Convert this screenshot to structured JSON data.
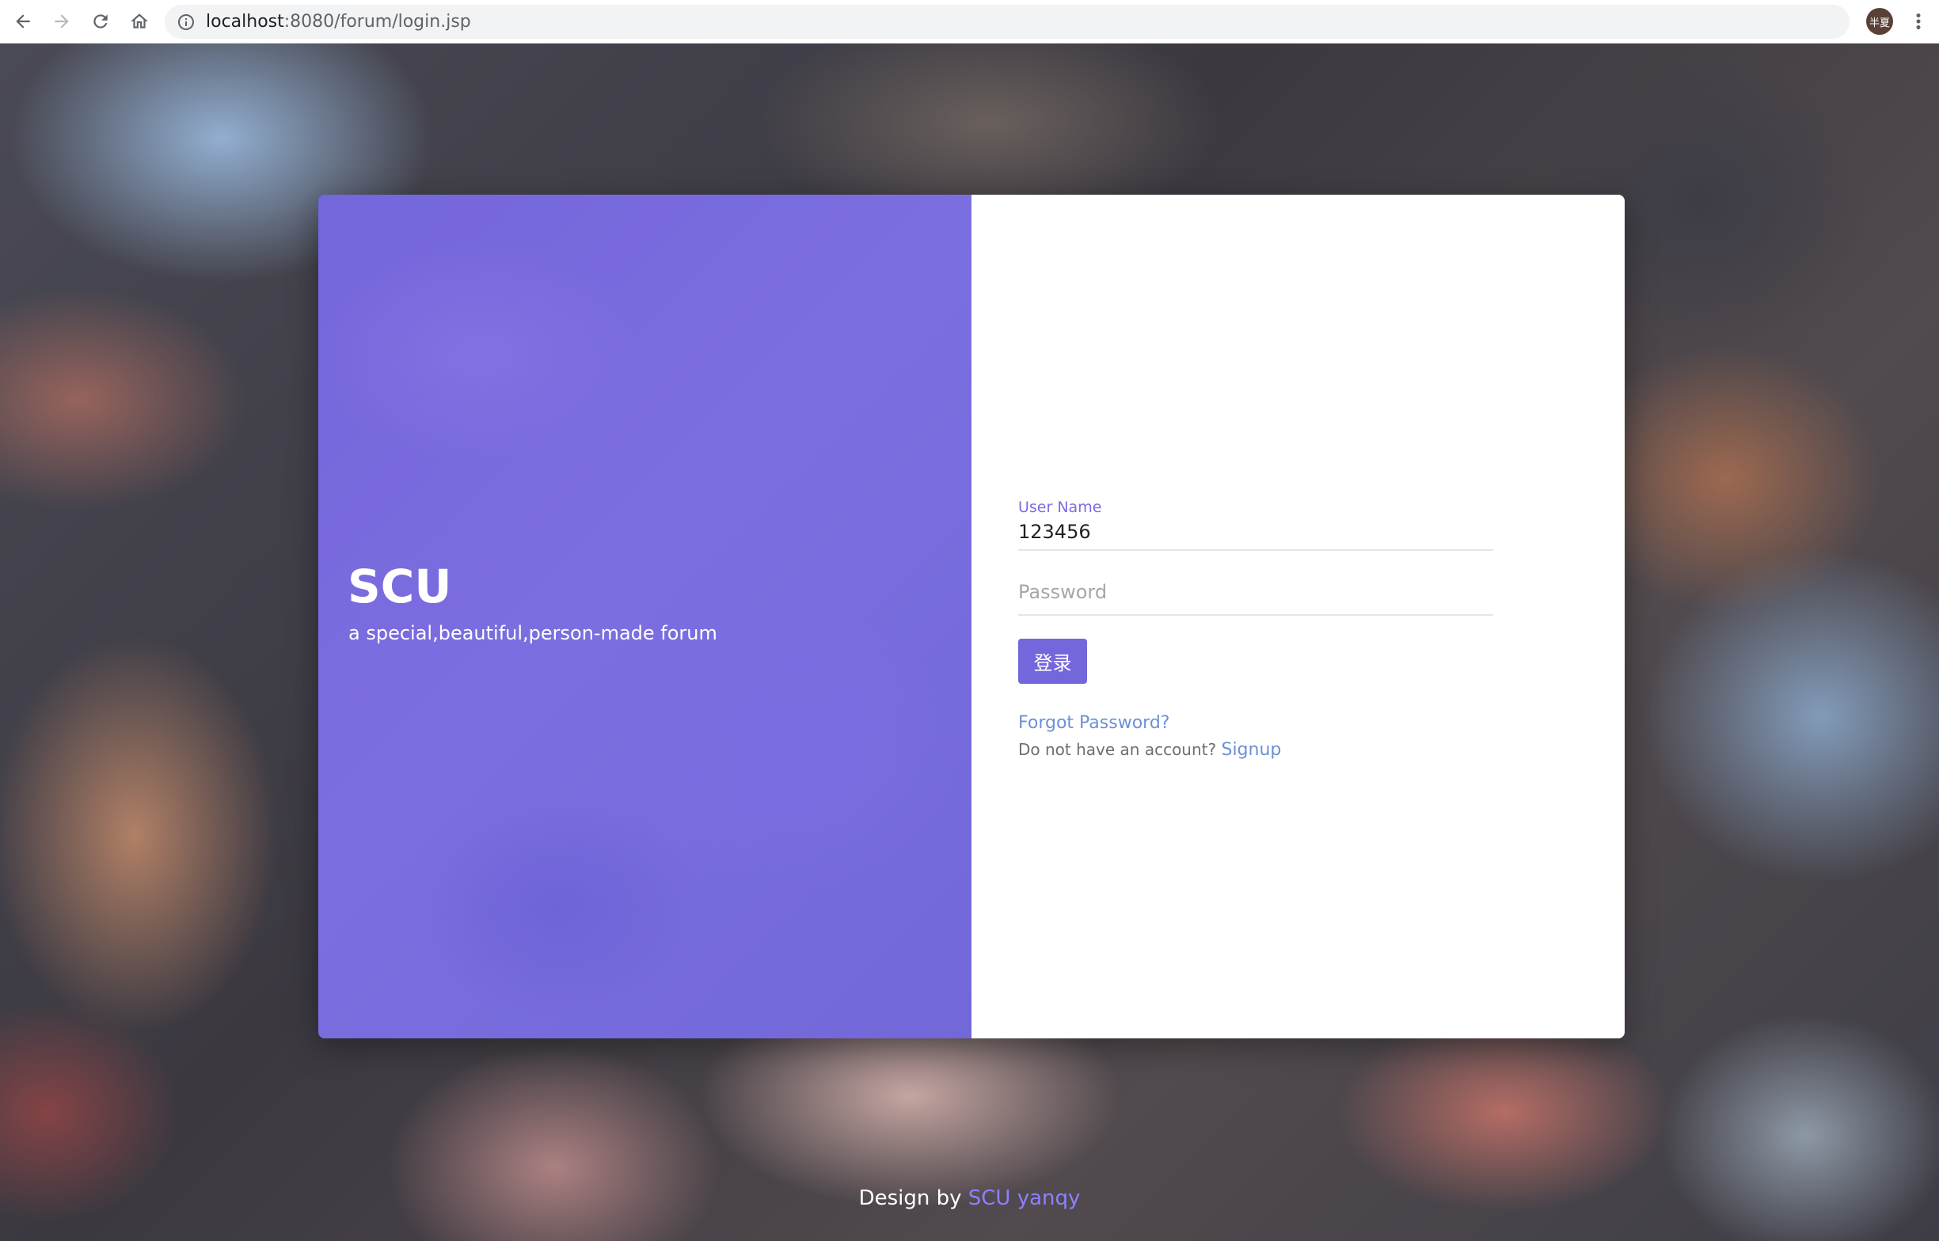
{
  "browser": {
    "url_host": "localhost",
    "url_path": ":8080/forum/login.jsp",
    "profile_initials": "半夏",
    "icons": {
      "back": "arrow-left-icon",
      "forward": "arrow-right-icon",
      "reload": "reload-icon",
      "home": "home-icon",
      "site_info": "info-icon",
      "bookmark": "star-icon",
      "menu": "more-vert-icon"
    }
  },
  "brand": {
    "title": "SCU",
    "tagline": "a special,beautiful,person-made forum"
  },
  "login_form": {
    "username_label": "User Name",
    "username_value": "123456",
    "password_placeholder": "Password",
    "submit_label": "登录",
    "forgot_password": "Forgot Password?",
    "no_account_text": "Do not have an account?",
    "signup_label": "Signup"
  },
  "footer": {
    "prefix": "Design by",
    "author": "SCU yanqy"
  },
  "colors": {
    "accent": "#7466db",
    "link": "#6b91d6",
    "label": "#7b6ee0"
  }
}
